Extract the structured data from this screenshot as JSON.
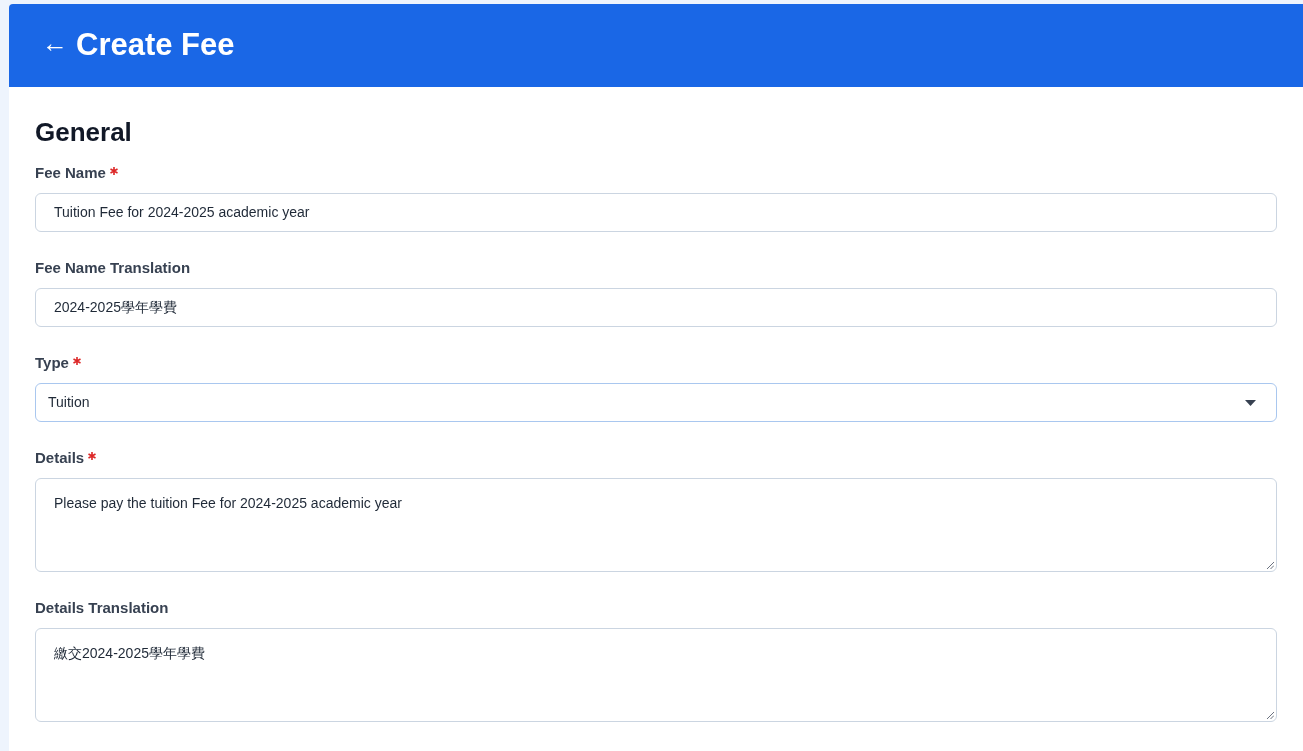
{
  "header": {
    "back_icon": "←",
    "title": "Create Fee"
  },
  "section": {
    "title": "General"
  },
  "fields": [
    {
      "kind": "text",
      "label": "Fee Name",
      "required": true,
      "value": "Tuition Fee for 2024-2025 academic year"
    },
    {
      "kind": "text",
      "label": "Fee Name Translation",
      "required": false,
      "value": "2024-2025學年學費"
    },
    {
      "kind": "select",
      "label": "Type",
      "required": true,
      "value": "Tuition"
    },
    {
      "kind": "textarea",
      "label": "Details",
      "required": true,
      "value": "Please pay the tuition Fee for 2024-2025 academic year"
    },
    {
      "kind": "textarea",
      "label": "Details Translation",
      "required": false,
      "value": "繳交2024-2025學年學費"
    }
  ]
}
